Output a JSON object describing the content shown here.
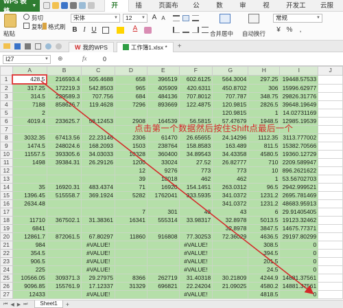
{
  "menubar": {
    "app": "WPS 表格",
    "tabs": [
      "开始",
      "插入",
      "页面布局",
      "公式",
      "数据",
      "审阅",
      "视图",
      "开发工具",
      "云服务"
    ],
    "active_tab": "开始"
  },
  "ribbon": {
    "paste": "粘贴",
    "cut": "剪切",
    "copy": "复制",
    "format_painter": "格式刷",
    "font_name": "宋体",
    "font_size": "12",
    "merge_center": "合并居中",
    "wrap_text": "自动换行",
    "number_format": "常规",
    "currency_symbol": "¥"
  },
  "docbar": {
    "tab_mywps": "我的WPS",
    "tab_workbook": "工作簿1.xlsx *"
  },
  "formula": {
    "cell_ref": "I27",
    "fx": "fx",
    "value": "0"
  },
  "columns": [
    "A",
    "B",
    "C",
    "D",
    "E",
    "F",
    "G",
    "H",
    "I",
    "J"
  ],
  "rows": [
    [
      "428.5",
      "216593.4",
      "505.4688",
      "658",
      "396519",
      "602.6125",
      "564.3004",
      "297.25",
      "19448.57533"
    ],
    [
      "317.25",
      "172219.3",
      "542.8503",
      "965",
      "405909",
      "420.6311",
      "450.8702",
      "306",
      "15996.62977"
    ],
    [
      "314.5",
      "229589.3",
      "707.756",
      "684",
      "484136",
      "707.8012",
      "707.787",
      "348.75",
      "29826.31776"
    ],
    [
      "7188",
      "858626.7",
      "119.4628",
      "7296",
      "893669",
      "122.4875",
      "120.9815",
      "2826.5",
      "39648.19649"
    ],
    [
      "2",
      "",
      "",
      "",
      "",
      "",
      "120.9815",
      "1",
      "14.02731169"
    ],
    [
      "4019.4",
      "233625.7",
      "58.12453",
      "2908",
      "164539",
      "56.5815",
      "57.47679",
      "1948.5",
      "12985.19539"
    ],
    [
      "",
      "",
      "",
      "",
      "",
      "",
      "",
      "",
      ""
    ],
    [
      "3032.35",
      "67413.56",
      "22.23146",
      "2306",
      "61470",
      "26.65655",
      "24.14296",
      "1112.35",
      "3113.777002"
    ],
    [
      "1474.5",
      "248024.6",
      "168.2093",
      "1503",
      "238764",
      "158.8583",
      "163.489",
      "811.5",
      "15382.70566"
    ],
    [
      "11557.5",
      "393305.6",
      "34.03033",
      "10328",
      "360400",
      "34.89543",
      "34.43358",
      "4580.5",
      "19360.12729"
    ],
    [
      "1498",
      "39384.31",
      "26.29126",
      "1200",
      "33024",
      "27.52",
      "26.82777",
      "710",
      "2209.589947"
    ],
    [
      "",
      "",
      "",
      "12",
      "9276",
      "773",
      "773",
      "10",
      "896.2621622"
    ],
    [
      "",
      "",
      "",
      "39",
      "18018",
      "462",
      "462",
      "1",
      "53.56702703"
    ],
    [
      "35",
      "16920.31",
      "483.4374",
      "71",
      "16920",
      "154.1451",
      "263.0312",
      "96.5",
      "2942.999521"
    ],
    [
      "1396.45",
      "515558.7",
      "369.1924",
      "5282",
      "1762041",
      "333.5935",
      "341.0372",
      "1231.2",
      "2695.781469"
    ],
    [
      "2634.48",
      "",
      "",
      "",
      "",
      "",
      "341.0372",
      "1231.2",
      "48683.95913"
    ],
    [
      "",
      "",
      "",
      "7",
      "301",
      "43",
      "43",
      "6",
      "29.91405405"
    ],
    [
      "11710",
      "367502.1",
      "31.38361",
      "16341",
      "555314",
      "33.98317",
      "32.8978",
      "5013.5",
      "19123.32462"
    ],
    [
      "6841",
      "",
      "",
      "",
      "",
      "",
      "32.8978",
      "3847.5",
      "14675.77371"
    ],
    [
      "12861.7",
      "872061.5",
      "67.80297",
      "11860",
      "916808",
      "77.30253",
      "72.36029",
      "4636.5",
      "29197.80299"
    ],
    [
      "984",
      "",
      "#VALUE!",
      "",
      "",
      "#VALUE!",
      "",
      "308.5",
      "0"
    ],
    [
      "354.5",
      "",
      "#VALUE!",
      "",
      "",
      "#VALUE!",
      "",
      "394.5",
      "0"
    ],
    [
      "906.5",
      "",
      "#VALUE!",
      "",
      "",
      "#VALUE!",
      "",
      "201.5",
      "0"
    ],
    [
      "225",
      "",
      "#VALUE!",
      "",
      "",
      "#VALUE!",
      "",
      "24.5",
      "0"
    ],
    [
      "10566.05",
      "309371.3",
      "29.27975",
      "8366",
      "262719",
      "31.40318",
      "30.21809",
      "4244.9",
      "14881.37561"
    ],
    [
      "9096.85",
      "155761.9",
      "17.12337",
      "31329",
      "696821",
      "22.24204",
      "21.09025",
      "4580.2",
      "14881.37561"
    ],
    [
      "12433",
      "",
      "#VALUE!",
      "",
      "",
      "#VALUE!",
      "",
      "4818.5",
      "0"
    ]
  ],
  "annotation": "点击第一个数据然后按住Shift点最后一个",
  "sheetbar": {
    "sheet": "Sheet1",
    "add": "+"
  },
  "colors": {
    "brand_green": "#2f7d32",
    "selection_fill": "#b5dfa9",
    "annotation_red": "#d42a2a"
  }
}
